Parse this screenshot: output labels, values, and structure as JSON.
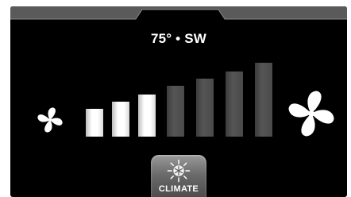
{
  "header": {
    "temperature": "75°",
    "separator": "•",
    "wind_direction": "SW",
    "readout": "75° • SW"
  },
  "fan_speed": {
    "level": 3,
    "max_level": 7,
    "decrease_icon": "fan-small-icon",
    "increase_icon": "fan-large-icon"
  },
  "climate_button": {
    "label": "CLIMATE",
    "icon": "sun-snowflake-icon"
  },
  "colors": {
    "background": "#000000",
    "bar_active": "#ffffff",
    "bar_inactive": "#4a4a4a",
    "button": "#6a6a6a"
  }
}
